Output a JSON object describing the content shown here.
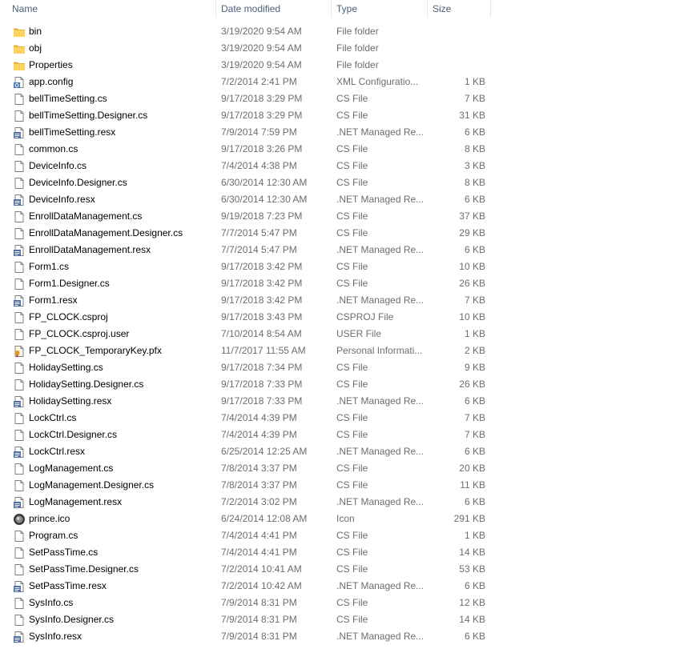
{
  "columns": {
    "name": "Name",
    "date": "Date modified",
    "type": "Type",
    "size": "Size"
  },
  "files": [
    {
      "name": "bin",
      "date": "3/19/2020 9:54 AM",
      "type": "File folder",
      "size": "",
      "icon": "folder-icon"
    },
    {
      "name": "obj",
      "date": "3/19/2020 9:54 AM",
      "type": "File folder",
      "size": "",
      "icon": "folder-icon"
    },
    {
      "name": "Properties",
      "date": "3/19/2020 9:54 AM",
      "type": "File folder",
      "size": "",
      "icon": "folder-icon"
    },
    {
      "name": "app.config",
      "date": "7/2/2014 2:41 PM",
      "type": "XML Configuratio...",
      "size": "1 KB",
      "icon": "config-file-icon"
    },
    {
      "name": "bellTimeSetting.cs",
      "date": "9/17/2018 3:29 PM",
      "type": "CS File",
      "size": "7 KB",
      "icon": "document-icon"
    },
    {
      "name": "bellTimeSetting.Designer.cs",
      "date": "9/17/2018 3:29 PM",
      "type": "CS File",
      "size": "31 KB",
      "icon": "document-icon"
    },
    {
      "name": "bellTimeSetting.resx",
      "date": "7/9/2014 7:59 PM",
      "type": ".NET Managed Re...",
      "size": "6 KB",
      "icon": "resx-file-icon"
    },
    {
      "name": "common.cs",
      "date": "9/17/2018 3:26 PM",
      "type": "CS File",
      "size": "8 KB",
      "icon": "document-icon"
    },
    {
      "name": "DeviceInfo.cs",
      "date": "7/4/2014 4:38 PM",
      "type": "CS File",
      "size": "3 KB",
      "icon": "document-icon"
    },
    {
      "name": "DeviceInfo.Designer.cs",
      "date": "6/30/2014 12:30 AM",
      "type": "CS File",
      "size": "8 KB",
      "icon": "document-icon"
    },
    {
      "name": "DeviceInfo.resx",
      "date": "6/30/2014 12:30 AM",
      "type": ".NET Managed Re...",
      "size": "6 KB",
      "icon": "resx-file-icon"
    },
    {
      "name": "EnrollDataManagement.cs",
      "date": "9/19/2018 7:23 PM",
      "type": "CS File",
      "size": "37 KB",
      "icon": "document-icon"
    },
    {
      "name": "EnrollDataManagement.Designer.cs",
      "date": "7/7/2014 5:47 PM",
      "type": "CS File",
      "size": "29 KB",
      "icon": "document-icon"
    },
    {
      "name": "EnrollDataManagement.resx",
      "date": "7/7/2014 5:47 PM",
      "type": ".NET Managed Re...",
      "size": "6 KB",
      "icon": "resx-file-icon"
    },
    {
      "name": "Form1.cs",
      "date": "9/17/2018 3:42 PM",
      "type": "CS File",
      "size": "10 KB",
      "icon": "document-icon"
    },
    {
      "name": "Form1.Designer.cs",
      "date": "9/17/2018 3:42 PM",
      "type": "CS File",
      "size": "26 KB",
      "icon": "document-icon"
    },
    {
      "name": "Form1.resx",
      "date": "9/17/2018 3:42 PM",
      "type": ".NET Managed Re...",
      "size": "7 KB",
      "icon": "resx-file-icon"
    },
    {
      "name": "FP_CLOCK.csproj",
      "date": "9/17/2018 3:43 PM",
      "type": "CSPROJ File",
      "size": "10 KB",
      "icon": "document-icon"
    },
    {
      "name": "FP_CLOCK.csproj.user",
      "date": "7/10/2014 8:54 AM",
      "type": "USER File",
      "size": "1 KB",
      "icon": "document-icon"
    },
    {
      "name": "FP_CLOCK_TemporaryKey.pfx",
      "date": "11/7/2017 11:55 AM",
      "type": "Personal Informati...",
      "size": "2 KB",
      "icon": "certificate-icon"
    },
    {
      "name": "HolidaySetting.cs",
      "date": "9/17/2018 7:34 PM",
      "type": "CS File",
      "size": "9 KB",
      "icon": "document-icon"
    },
    {
      "name": "HolidaySetting.Designer.cs",
      "date": "9/17/2018 7:33 PM",
      "type": "CS File",
      "size": "26 KB",
      "icon": "document-icon"
    },
    {
      "name": "HolidaySetting.resx",
      "date": "9/17/2018 7:33 PM",
      "type": ".NET Managed Re...",
      "size": "6 KB",
      "icon": "resx-file-icon"
    },
    {
      "name": "LockCtrl.cs",
      "date": "7/4/2014 4:39 PM",
      "type": "CS File",
      "size": "7 KB",
      "icon": "document-icon"
    },
    {
      "name": "LockCtrl.Designer.cs",
      "date": "7/4/2014 4:39 PM",
      "type": "CS File",
      "size": "7 KB",
      "icon": "document-icon"
    },
    {
      "name": "LockCtrl.resx",
      "date": "6/25/2014 12:25 AM",
      "type": ".NET Managed Re...",
      "size": "6 KB",
      "icon": "resx-file-icon"
    },
    {
      "name": "LogManagement.cs",
      "date": "7/8/2014 3:37 PM",
      "type": "CS File",
      "size": "20 KB",
      "icon": "document-icon"
    },
    {
      "name": "LogManagement.Designer.cs",
      "date": "7/8/2014 3:37 PM",
      "type": "CS File",
      "size": "11 KB",
      "icon": "document-icon"
    },
    {
      "name": "LogManagement.resx",
      "date": "7/2/2014 3:02 PM",
      "type": ".NET Managed Re...",
      "size": "6 KB",
      "icon": "resx-file-icon"
    },
    {
      "name": "prince.ico",
      "date": "6/24/2014 12:08 AM",
      "type": "Icon",
      "size": "291 KB",
      "icon": "ico-file-icon"
    },
    {
      "name": "Program.cs",
      "date": "7/4/2014 4:41 PM",
      "type": "CS File",
      "size": "1 KB",
      "icon": "document-icon"
    },
    {
      "name": "SetPassTime.cs",
      "date": "7/4/2014 4:41 PM",
      "type": "CS File",
      "size": "14 KB",
      "icon": "document-icon"
    },
    {
      "name": "SetPassTime.Designer.cs",
      "date": "7/2/2014 10:41 AM",
      "type": "CS File",
      "size": "53 KB",
      "icon": "document-icon"
    },
    {
      "name": "SetPassTime.resx",
      "date": "7/2/2014 10:42 AM",
      "type": ".NET Managed Re...",
      "size": "6 KB",
      "icon": "resx-file-icon"
    },
    {
      "name": "SysInfo.cs",
      "date": "7/9/2014 8:31 PM",
      "type": "CS File",
      "size": "12 KB",
      "icon": "document-icon"
    },
    {
      "name": "SysInfo.Designer.cs",
      "date": "7/9/2014 8:31 PM",
      "type": "CS File",
      "size": "14 KB",
      "icon": "document-icon"
    },
    {
      "name": "SysInfo.resx",
      "date": "7/9/2014 8:31 PM",
      "type": ".NET Managed Re...",
      "size": "6 KB",
      "icon": "resx-file-icon"
    }
  ]
}
